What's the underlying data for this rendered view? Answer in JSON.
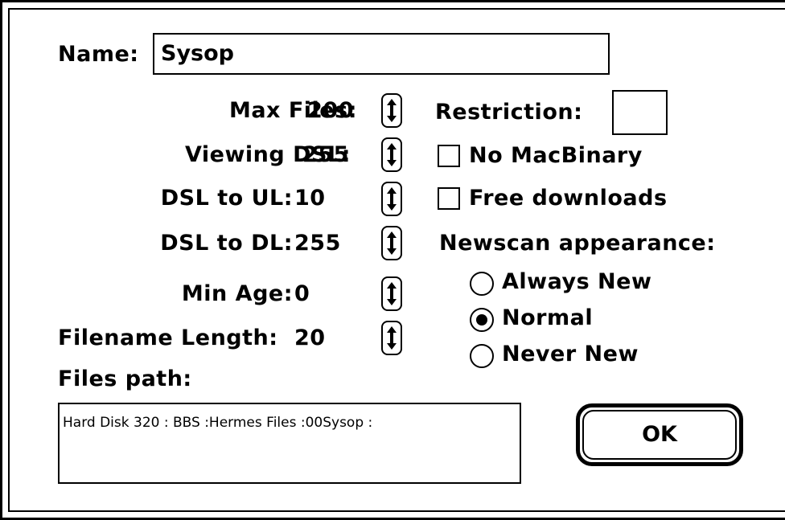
{
  "dialog": {
    "name_label": "Name:",
    "name_value": "Sysop",
    "fields": [
      {
        "label": "Max Files:",
        "value": "200"
      },
      {
        "label": "Viewing DSL:",
        "value": "255"
      },
      {
        "label": "DSL to UL:",
        "value": "10"
      },
      {
        "label": "DSL to DL:",
        "value": "255"
      },
      {
        "label": "Min Age:",
        "value": "0"
      },
      {
        "label": "Filename Length:",
        "value": "20"
      }
    ],
    "restriction_label": "Restriction:",
    "restriction_value": "",
    "checkboxes": [
      {
        "label": "No MacBinary",
        "checked": false
      },
      {
        "label": "Free downloads",
        "checked": false
      }
    ],
    "newscan_label": "Newscan appearance:",
    "newscan_options": [
      {
        "label": "Always New",
        "selected": false
      },
      {
        "label": "Normal",
        "selected": true
      },
      {
        "label": "Never New",
        "selected": false
      }
    ],
    "files_path_label": "Files path:",
    "files_path_value": "Hard Disk 320 : BBS :Hermes Files :00Sysop :",
    "ok_label": "OK"
  }
}
